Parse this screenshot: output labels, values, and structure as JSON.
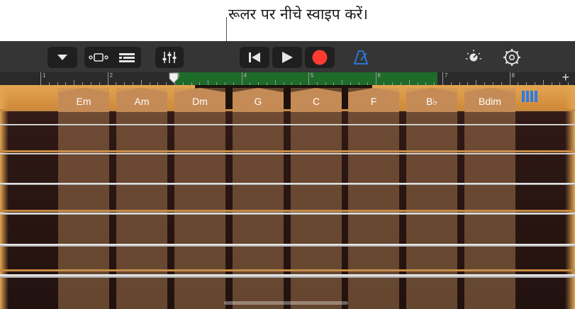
{
  "callout": {
    "text": "रूलर पर नीचे स्वाइप करें।"
  },
  "toolbar": {
    "icons": [
      "view-menu-icon",
      "browser-icon",
      "tracks-icon",
      "mixer-icon",
      "go-to-beginning-icon",
      "play-icon",
      "record-icon",
      "metronome-icon",
      "master-volume-icon",
      "settings-icon"
    ],
    "colors": {
      "background": "#353535",
      "button": "#1f1f1f",
      "record": "#ff3b30",
      "metronome": "#2c7be5"
    }
  },
  "ruler": {
    "bar_labels": [
      "1",
      "2",
      "3",
      "4",
      "5",
      "6",
      "7",
      "8"
    ],
    "add_section_label": "+",
    "region_color": "#1e6b2a"
  },
  "chords": [
    "Em",
    "Am",
    "Dm",
    "G",
    "C",
    "F",
    "B♭",
    "Bdim"
  ],
  "strings_count": 6
}
